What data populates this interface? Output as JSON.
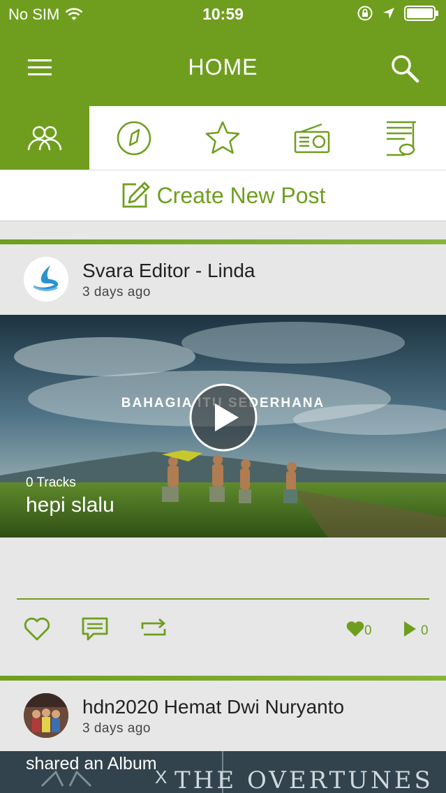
{
  "status": {
    "carrier": "No SIM",
    "time": "10:59"
  },
  "nav": {
    "title": "HOME"
  },
  "tabs": [
    {
      "name": "community-icon",
      "active": true
    },
    {
      "name": "compass-icon",
      "active": false
    },
    {
      "name": "star-icon",
      "active": false
    },
    {
      "name": "radio-icon",
      "active": false
    },
    {
      "name": "playlist-icon",
      "active": false
    }
  ],
  "create_post": {
    "label": "Create New Post"
  },
  "posts": [
    {
      "author": "Svara Editor - Linda",
      "time_ago": "3 days ago",
      "media_caption": "BAHAGIA ITU SEDERHANA",
      "tracks": "0 Tracks",
      "title": "hepi slalu",
      "likes": "0",
      "plays": "0"
    },
    {
      "author": "hdn2020 Hemat Dwi Nuryanto",
      "time_ago": "3 days ago",
      "shared_text": "shared an Album",
      "banner_text": "THE OVERTUNES",
      "banner_prefix": "X"
    }
  ],
  "colors": {
    "brand": "#6f9e1f",
    "background": "#e7e7e7"
  }
}
